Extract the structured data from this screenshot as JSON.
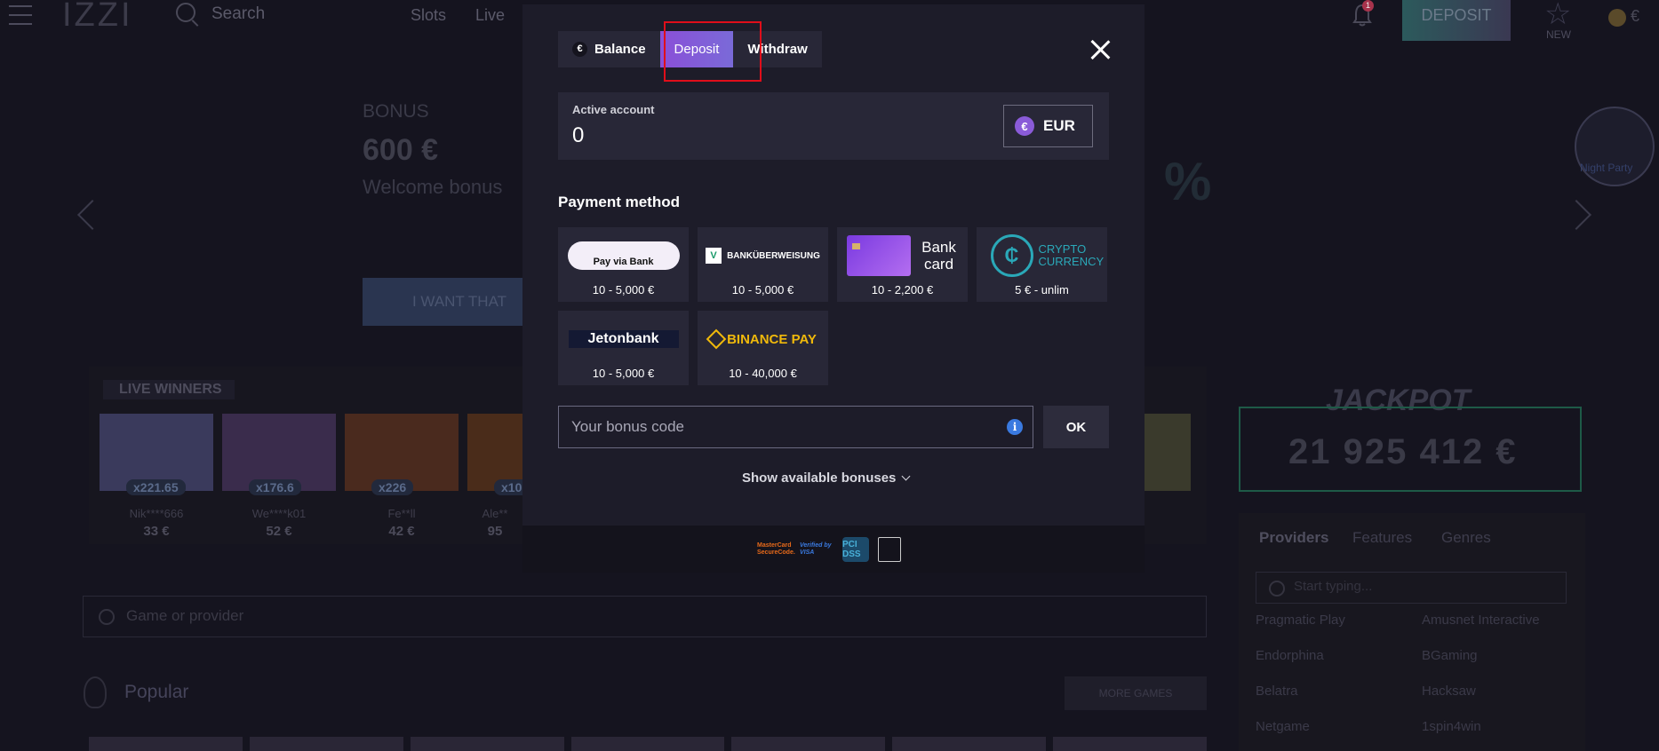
{
  "background": {
    "logo": "IZZI",
    "search_label": "Search",
    "nav": [
      "Slots",
      "Live"
    ],
    "notification_count": "1",
    "deposit_button": "DEPOSIT",
    "new_label": "NEW",
    "banner": {
      "bonus_label": "BONUS",
      "bonus_amount": "600 €",
      "bonus_desc": "Welcome bonus",
      "cta": "I WANT THAT",
      "side_badge": "Night Party"
    },
    "live_winners": {
      "title": "LIVE WINNERS",
      "items": [
        {
          "mult": "x221.65",
          "name": "Nik****666",
          "amount": "33 €"
        },
        {
          "mult": "x176.6",
          "name": "We****k01",
          "amount": "52 €"
        },
        {
          "mult": "x226",
          "name": "Fe**ll",
          "amount": "42 €"
        },
        {
          "mult": "x10",
          "name": "Ale**",
          "amount": "95"
        }
      ]
    },
    "jackpot": {
      "title": "JACKPOT",
      "value": "21 925 412 €"
    },
    "providers_panel": {
      "tabs": [
        "Providers",
        "Features",
        "Genres"
      ],
      "search_placeholder": "Start typing...",
      "items": [
        "Pragmatic Play",
        "Amusnet Interactive",
        "Endorphina",
        "BGaming",
        "Belatra",
        "Hacksaw",
        "Netgame",
        "1spin4win"
      ]
    },
    "game_search_placeholder": "Game or provider",
    "popular_title": "Popular",
    "more_games": "MORE GAMES"
  },
  "modal": {
    "tabs": [
      {
        "label": "Balance",
        "icon": "€"
      },
      {
        "label": "Deposit"
      },
      {
        "label": "Withdraw"
      }
    ],
    "active_tab": "Deposit",
    "account": {
      "label": "Active account",
      "value": "0",
      "currency_icon": "€",
      "currency": "EUR"
    },
    "payment_title": "Payment method",
    "methods": [
      {
        "name": "Pay via Bank",
        "range": "10 - 5,000 €"
      },
      {
        "name": "BANKÜBERWEISUNG",
        "range": "10 - 5,000 €"
      },
      {
        "name": "Bank card",
        "range": "10 - 2,200 €"
      },
      {
        "name": "CRYPTO CURRENCY",
        "range": "5 € - unlim"
      },
      {
        "name": "Jetonbank",
        "range": "10 - 5,000 €"
      },
      {
        "name": "BINANCE PAY",
        "range": "10 - 40,000 €"
      }
    ],
    "bonus_placeholder": "Your bonus code",
    "ok_label": "OK",
    "show_bonuses": "Show available bonuses",
    "footer_logos": {
      "mastercard": "MasterCard SecureCode.",
      "visa": "Verified by VISA",
      "pci": "PCI DSS"
    }
  }
}
